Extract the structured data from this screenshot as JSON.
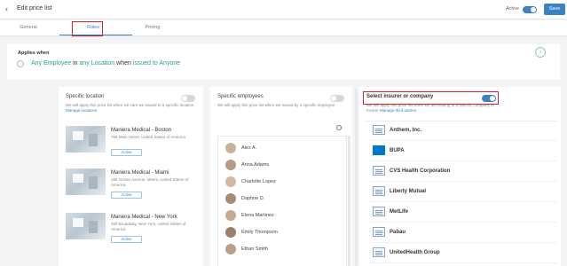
{
  "header": {
    "back_icon": "chevron-left-icon",
    "title": "Edit price list",
    "active_label": "Active",
    "save_label": "Save"
  },
  "tabs": [
    {
      "label": "General",
      "active": false
    },
    {
      "label": "Rules",
      "active": true
    },
    {
      "label": "Pricing",
      "active": false
    }
  ],
  "applies": {
    "label": "Applies when",
    "parts": [
      "Any Employee",
      " in ",
      "any Location",
      " when ",
      "issued to Anyone"
    ],
    "info_icon": "info-circle-icon"
  },
  "locations": {
    "title": "Specific location",
    "desc": "We will apply this price list when we care we issued to a specific location",
    "link": "Manage locations",
    "items": [
      {
        "name": "Maniera Medical - Boston",
        "address": "759 Main Street, United States of America",
        "button": "Active"
      },
      {
        "name": "Maniera Medical - Miami",
        "address": "155 Ocean Avenue, Miami, United States of America",
        "button": "Active"
      },
      {
        "name": "Maniera Medical - New York",
        "address": "450 Broadway, New York, United States of America",
        "button": "Active"
      }
    ]
  },
  "employees": {
    "title": "Specific employees",
    "desc": "We will apply this price list when we issued by a specific employee",
    "search_icon": "search-icon",
    "items": [
      "Alex A.",
      "Anna Adams",
      "Charlotte Lopez",
      "Daphne D.",
      "Elena Martinez",
      "Emily Thompson",
      "Ethan Smith"
    ]
  },
  "insurers": {
    "title": "Select insurer or company",
    "desc": "We will apply this price list when we are issuing to a specific company or insurer",
    "link": "Manage third parties",
    "items": [
      "Anthem, Inc.",
      "BUPA",
      "CVS Health Corporation",
      "Liberty Mutual",
      "MetLife",
      "Pabau",
      "UnitedHealth Group"
    ]
  },
  "colors": {
    "accent": "#3b82c4",
    "highlight": "#2a9d8f",
    "annotation": "#d2222d"
  }
}
